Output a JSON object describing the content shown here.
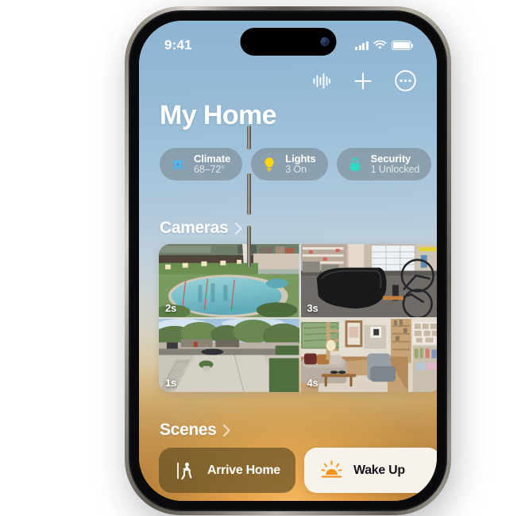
{
  "device": {
    "frame": "iphone-15-pro-titanium",
    "buttons": [
      "action-button",
      "volume-up",
      "volume-down",
      "power-button"
    ]
  },
  "status_bar": {
    "time": "9:41",
    "cellular_icon": "signal-bars-icon",
    "wifi_icon": "wifi-icon",
    "battery_icon": "battery-full-icon"
  },
  "toolbar": {
    "items": [
      {
        "name": "siri-waveform-icon",
        "label": "Siri"
      },
      {
        "name": "plus-icon",
        "label": "Add"
      },
      {
        "name": "more-ellipsis-icon",
        "label": "More"
      }
    ]
  },
  "header": {
    "title": "My Home"
  },
  "status_pills": [
    {
      "title": "Climate",
      "subtitle": "68–72°",
      "icon": "fan-icon",
      "color": "#4fb3f0"
    },
    {
      "title": "Lights",
      "subtitle": "3 On",
      "icon": "lightbulb-icon",
      "color": "#ffd60a"
    },
    {
      "title": "Security",
      "subtitle": "1 Unlocked",
      "icon": "lock-icon",
      "color": "#2fd8c4"
    }
  ],
  "sections": {
    "cameras": {
      "title": "Cameras",
      "chevron": "chevron-right-icon"
    },
    "scenes": {
      "title": "Scenes",
      "chevron": "chevron-right-icon"
    }
  },
  "cameras": [
    {
      "name": "pool-camera",
      "timestamp": "2s"
    },
    {
      "name": "garage-camera",
      "timestamp": "3s"
    },
    {
      "name": "driveway-camera",
      "timestamp": "1s"
    },
    {
      "name": "living-room-camera",
      "timestamp": "4s"
    }
  ],
  "scenes": [
    {
      "label": "Arrive Home",
      "icon": "walking-person-door-icon",
      "style": "dark"
    },
    {
      "label": "Wake Up",
      "icon": "sunrise-icon",
      "style": "light",
      "accent": "#f7931a"
    }
  ],
  "colors": {
    "wallpaper_top": "#8db4d3",
    "wallpaper_bottom": "#ae6a22",
    "pill_background": "rgba(120,132,142,0.58)"
  }
}
